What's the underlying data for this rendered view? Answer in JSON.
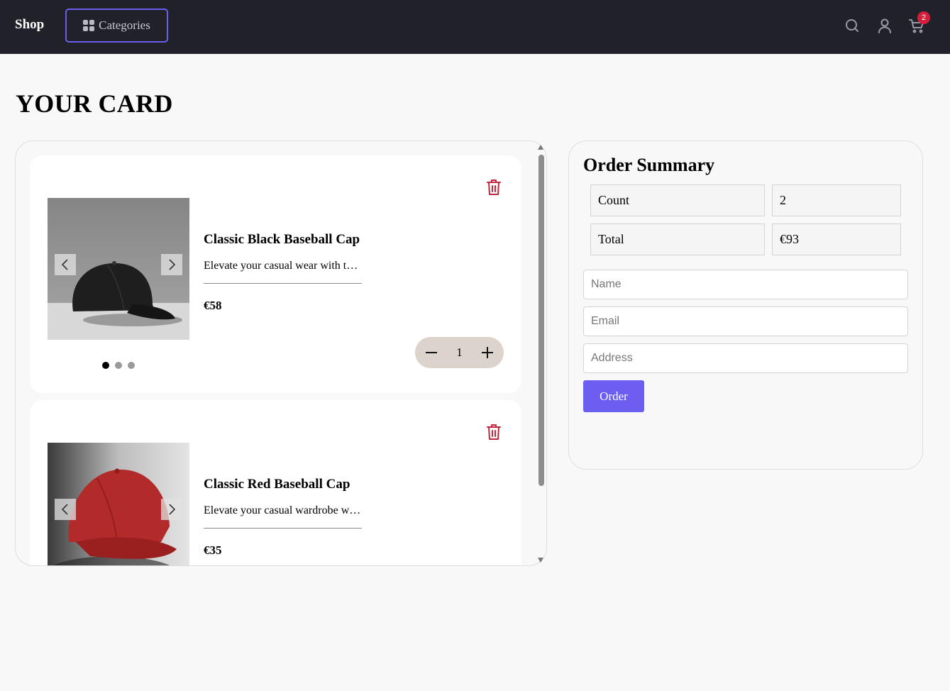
{
  "header": {
    "brand": "Shop",
    "categories_label": "Categories",
    "cart_count": "2",
    "icons": [
      "grid-icon",
      "search-icon",
      "user-icon",
      "cart-icon"
    ]
  },
  "page": {
    "title": "YOUR CARD"
  },
  "cart": {
    "items": [
      {
        "name": "Classic Black Baseball Cap",
        "description": "Elevate your casual wear with this classic black baseball cap",
        "price": "€58",
        "quantity": "1",
        "image": "black-baseball-cap-photo",
        "carousel_dots": 3,
        "active_dot": 0
      },
      {
        "name": "Classic Red Baseball Cap",
        "description": "Elevate your casual wardrobe with this classic red baseball cap",
        "price": "€35",
        "image": "red-baseball-cap-photo"
      }
    ]
  },
  "summary": {
    "title": "Order Summary",
    "count_label": "Count",
    "count_value": "2",
    "total_label": "Total",
    "total_value": "€93",
    "name_placeholder": "Name",
    "email_placeholder": "Email",
    "address_placeholder": "Address",
    "order_label": "Order"
  },
  "colors": {
    "header_bg": "#21212a",
    "accent": "#6b5ef0",
    "badge": "#d31f3c",
    "trash": "#c0263c",
    "stepper_bg": "#dcd3cd"
  }
}
